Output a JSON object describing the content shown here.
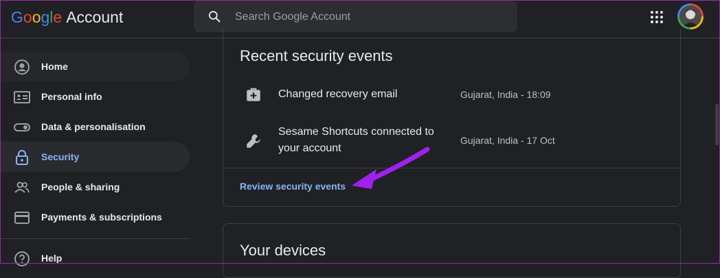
{
  "header": {
    "logo_google": "Google",
    "logo_account": "Account",
    "search_placeholder": "Search Google Account",
    "apps_icon": "apps-grid-icon",
    "avatar_icon": "profile-avatar"
  },
  "sidebar": {
    "items": [
      {
        "label": "Home",
        "icon": "home-account-icon"
      },
      {
        "label": "Personal info",
        "icon": "id-card-icon"
      },
      {
        "label": "Data & personalisation",
        "icon": "toggle-icon"
      },
      {
        "label": "Security",
        "icon": "lock-icon",
        "active": true
      },
      {
        "label": "People & sharing",
        "icon": "people-icon"
      },
      {
        "label": "Payments & subscriptions",
        "icon": "card-icon"
      },
      {
        "label": "Help",
        "icon": "help-icon"
      }
    ]
  },
  "main": {
    "recent_events": {
      "title": "Recent security events",
      "events": [
        {
          "title": "Changed recovery email",
          "meta": "Gujarat, India - 18:09",
          "icon": "medkit-icon"
        },
        {
          "title": "Sesame Shortcuts connected to your account",
          "meta": "Gujarat, India - 17 Oct",
          "icon": "wrench-icon"
        }
      ],
      "review_link": "Review security events"
    },
    "devices": {
      "title": "Your devices"
    }
  },
  "colors": {
    "background": "#202124",
    "accent": "#8ab4f8",
    "annotation_arrow": "#a020f0"
  }
}
